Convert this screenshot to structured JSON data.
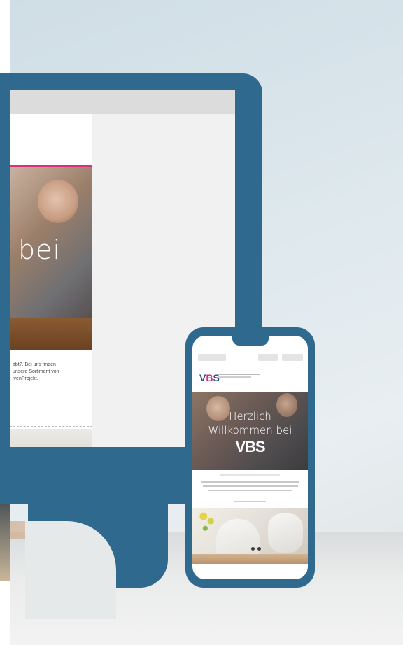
{
  "desktop_email": {
    "hero_word": "bei",
    "body_lines": [
      "abt?. Bei uns finden",
      "unsere Sortiment von",
      "ivenProjekt."
    ]
  },
  "phone_email": {
    "logo_v": "V",
    "logo_b": "B",
    "logo_s": "S",
    "hero_line1": "Herzlich",
    "hero_line2": "Willkommen bei",
    "hero_brand": "VBS"
  }
}
